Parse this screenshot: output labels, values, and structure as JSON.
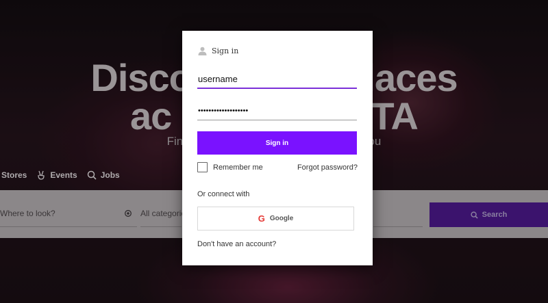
{
  "hero": {
    "title_line1": "Discov             places",
    "title_line2": "ac                    TA",
    "subtitle": "Find awes                              nts near you",
    "categories": [
      {
        "label": "Stores",
        "icon": "store-icon"
      },
      {
        "label": "Events",
        "icon": "peace-hand-icon"
      },
      {
        "label": "Jobs",
        "icon": "job-search-icon"
      }
    ]
  },
  "search": {
    "where_placeholder": "Where to look?",
    "category_placeholder": "All categorie",
    "button_label": "Search"
  },
  "modal": {
    "header": "Sign in",
    "username_value": "username",
    "password_value": "•••••••••••••••••••",
    "signin_label": "Sign in",
    "remember_label": "Remember me",
    "forgot_label": "Forgot password?",
    "or_connect": "Or connect with",
    "google_letter": "G",
    "google_label": "Google",
    "no_account": "Don't have an account?"
  },
  "colors": {
    "accent": "#7a12ff",
    "input_focus": "#7a2ed8",
    "search_button": "#3b136d",
    "google_red": "#e53935"
  }
}
